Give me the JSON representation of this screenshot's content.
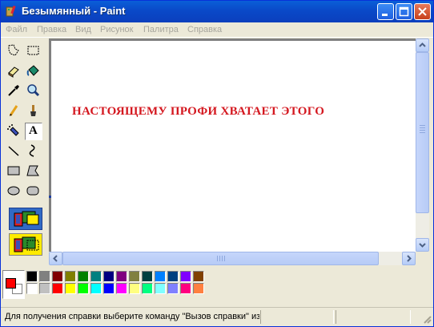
{
  "window": {
    "title": "Безымянный - Paint"
  },
  "menu": [
    {
      "label": "Файл"
    },
    {
      "label": "Правка"
    },
    {
      "label": "Вид"
    },
    {
      "label": "Рисунок"
    },
    {
      "label": "Палитра"
    },
    {
      "label": "Справка"
    }
  ],
  "tools": [
    {
      "icon": "free-form-select-icon",
      "selected": false
    },
    {
      "icon": "rect-select-icon",
      "selected": false
    },
    {
      "icon": "eraser-icon",
      "selected": false
    },
    {
      "icon": "fill-bucket-icon",
      "selected": false
    },
    {
      "icon": "color-picker-icon",
      "selected": false
    },
    {
      "icon": "magnifier-icon",
      "selected": false
    },
    {
      "icon": "pencil-icon",
      "selected": false
    },
    {
      "icon": "brush-icon",
      "selected": false
    },
    {
      "icon": "airbrush-icon",
      "selected": false
    },
    {
      "icon": "text-icon",
      "selected": true,
      "glyph": "A"
    },
    {
      "icon": "line-icon",
      "selected": false
    },
    {
      "icon": "curve-icon",
      "selected": false
    },
    {
      "icon": "rectangle-icon",
      "selected": false
    },
    {
      "icon": "polygon-icon",
      "selected": false
    },
    {
      "icon": "ellipse-icon",
      "selected": false
    },
    {
      "icon": "rounded-rect-icon",
      "selected": false
    }
  ],
  "canvas": {
    "text": "НАСТОЯЩЕМУ ПРОФИ ХВАТАЕТ ЭТОГО",
    "text_color": "#d4171f"
  },
  "colors": {
    "foreground": "#ff0000",
    "background": "#ffffff",
    "palette_top": [
      "#000000",
      "#808080",
      "#800000",
      "#808000",
      "#008000",
      "#008080",
      "#000080",
      "#800080",
      "#808040",
      "#004040",
      "#0080ff",
      "#004080",
      "#8000ff",
      "#804000"
    ],
    "palette_bottom": [
      "#ffffff",
      "#c0c0c0",
      "#ff0000",
      "#ffff00",
      "#00ff00",
      "#00ffff",
      "#0000ff",
      "#ff00ff",
      "#ffff80",
      "#00ff80",
      "#80ffff",
      "#8080ff",
      "#ff0080",
      "#ff8040"
    ]
  },
  "status": {
    "text": "Для получения справки выберите команду \"Вызов справки\" из"
  }
}
